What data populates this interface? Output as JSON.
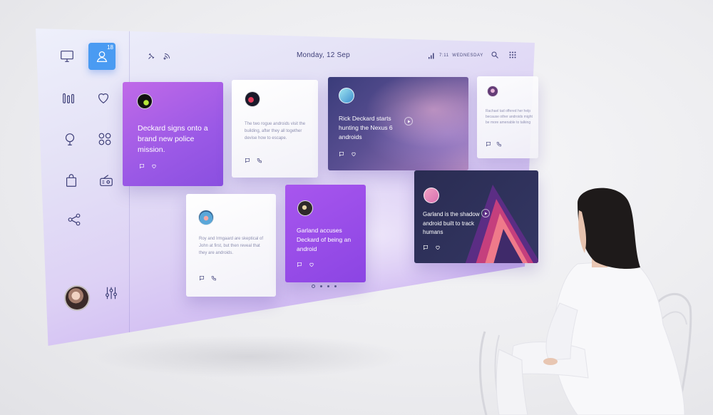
{
  "topbar": {
    "date": "Monday, 12 Sep",
    "time": "7:11",
    "weekday": "WEDNESDAY"
  },
  "sidebar": {
    "profile_badge": "18",
    "icons": [
      "monitor-icon",
      "user-icon",
      "bar-chart-icon",
      "heart-icon",
      "location-pin-icon",
      "grid-icon",
      "shopping-bag-icon",
      "radio-icon",
      "share-icon",
      "sliders-icon"
    ]
  },
  "cards": [
    {
      "title": "Deckard signs onto a brand new police mission."
    },
    {
      "text": "The two rogue androids visit the building, after they all together devise how to escape."
    },
    {
      "title": "Rick Deckard starts hunting the Nexus 6 androids"
    },
    {
      "text": "Rachael tad offered her help because other androids might be more amenable to talking"
    },
    {
      "text": "Roy and Irmgaard are skeptical of John at first, but then reveal that they are androids."
    },
    {
      "title": "Garland accuses Deckard of being an android"
    },
    {
      "title": "Garland is the shadow android built to track humans"
    }
  ],
  "pagination": {
    "pages": 4,
    "active": 1
  },
  "colors": {
    "accent": "#4a9bf2",
    "purple": "#9b59e6",
    "dark_card": "#2a2c52",
    "text_muted": "#8d8fb0",
    "heading": "#3e3f78"
  }
}
